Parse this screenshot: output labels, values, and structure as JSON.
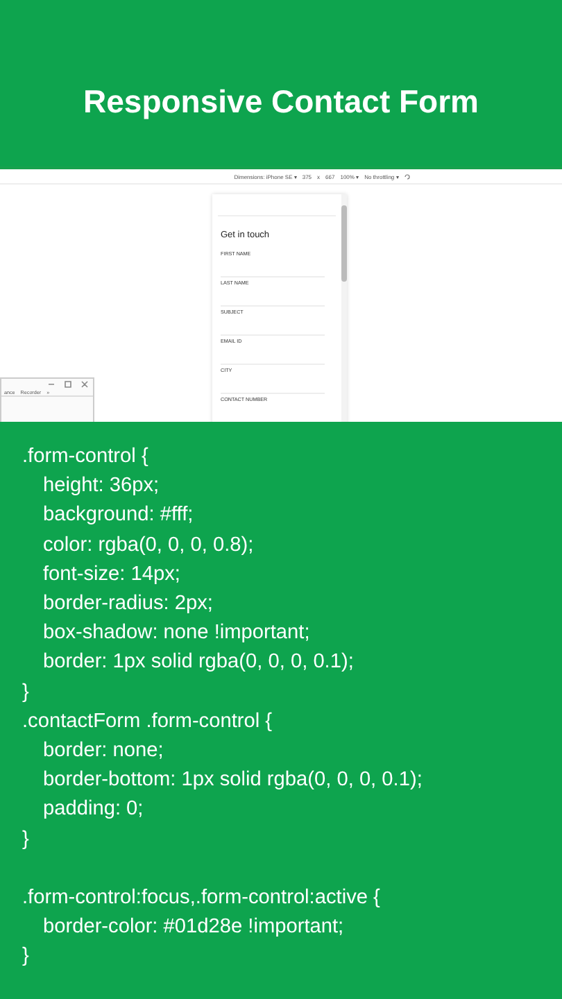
{
  "title": "Responsive Contact Form",
  "preview": {
    "toolbar": [
      "Dimensions: iPhone SE ▾",
      "375",
      "x",
      "667",
      "100% ▾",
      "No throttling ▾"
    ],
    "form_heading": "Get in touch",
    "fields": [
      {
        "label": "FIRST NAME"
      },
      {
        "label": "LAST NAME"
      },
      {
        "label": "SUBJECT"
      },
      {
        "label": "EMAIL ID"
      },
      {
        "label": "CITY"
      },
      {
        "label": "CONTACT NUMBER"
      }
    ],
    "mini_window": {
      "tabs": [
        "ance",
        "Recorder",
        "»"
      ]
    }
  },
  "code": [
    {
      "selector": ".form-control {",
      "declarations": [
        "height: 36px;",
        "background: #fff;",
        "color: rgba(0, 0, 0, 0.8);",
        "font-size: 14px;",
        "border-radius: 2px;",
        "box-shadow: none !important;",
        "border: 1px solid rgba(0, 0, 0, 0.1);"
      ],
      "close": "}",
      "spaced_before": false
    },
    {
      "selector": ".contactForm .form-control {",
      "declarations": [
        "border: none;",
        "border-bottom: 1px solid rgba(0, 0, 0, 0.1);",
        "padding: 0;"
      ],
      "close": "}",
      "spaced_before": false
    },
    {
      "selector": ".form-control:focus,.form-control:active {",
      "declarations": [
        "border-color: #01d28e !important;"
      ],
      "close": "}",
      "spaced_before": true
    }
  ]
}
